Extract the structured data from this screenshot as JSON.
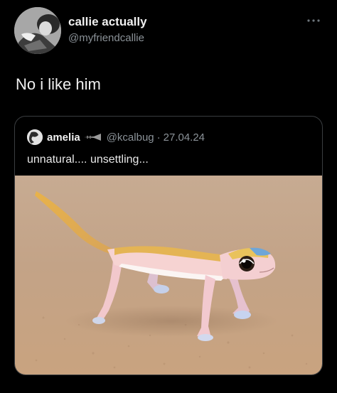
{
  "author": {
    "name": "callie actually",
    "handle": "@myfriendcallie",
    "avatar_icon": "profile-photo-icon"
  },
  "more_icon": "more-options-icon",
  "tweet": {
    "text": "No i like him"
  },
  "quoted_tweet": {
    "name": "amelia",
    "name_emoji": "trumpet-emoji",
    "handle": "@kcalbug",
    "separator": "·",
    "date": "27.04.24",
    "text": "unnatural.... unsettling...",
    "image_subject": "pale pink gecko on sand"
  },
  "colors": {
    "background": "#000000",
    "primary_text": "#e7e9ea",
    "secondary_text": "#8b9298",
    "border": "#3a3d40",
    "sand": "#c4a78a"
  }
}
